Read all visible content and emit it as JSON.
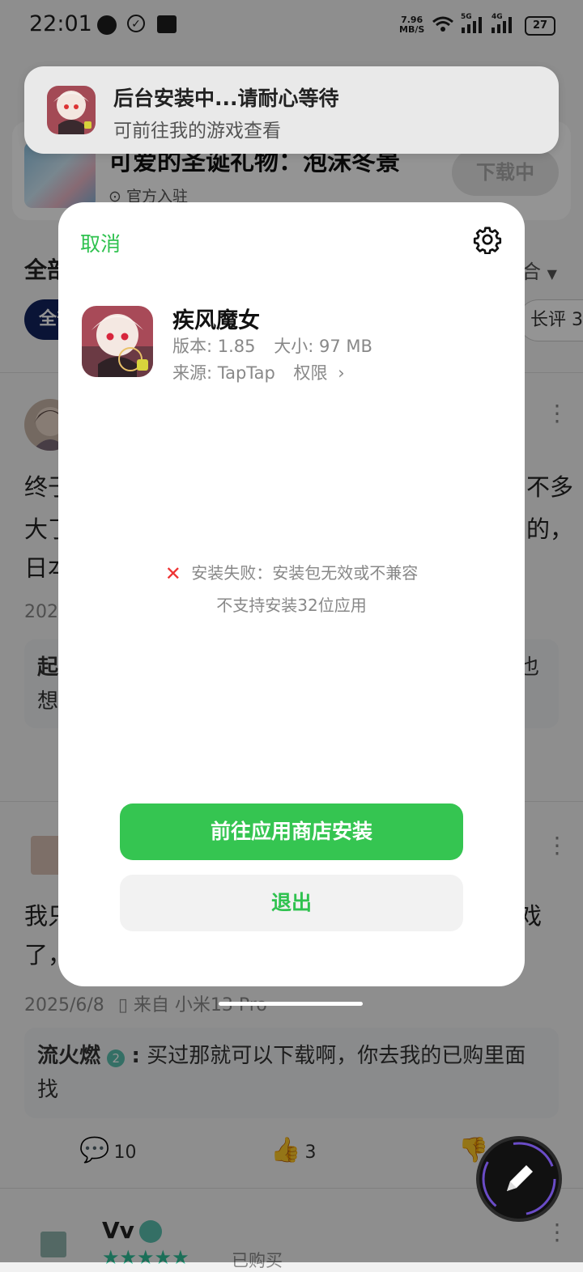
{
  "status_bar": {
    "time": "22:01",
    "net_speed_value": "7.96",
    "net_speed_unit": "MB/S",
    "signal_1": "5G",
    "signal_2": "4G",
    "battery": "27"
  },
  "toast": {
    "title": "后台安装中...请耐心等待",
    "subtitle": "可前往我的游戏查看"
  },
  "background": {
    "promo_title": "可爱的圣诞礼物：泡沫冬景",
    "promo_sub": "官方入驻",
    "download_button": "下载中",
    "filter_heading": "全部",
    "sort_label": "综合",
    "chip_all": "全部",
    "chip_long": "长评 3",
    "review1": {
      "line1": "终于",
      "line1_end": "不多",
      "line2": "大了",
      "line2_end": "的，",
      "line3": "日本",
      "date": "2025",
      "reply_line1_start": "起",
      "reply_line1_end": "也",
      "reply_line2": "想"
    },
    "review2": {
      "line1": "我只",
      "line1_end": "戏",
      "line2": "了，",
      "date": "2025/6/8",
      "device": "来自 小米13 Pro",
      "reply_user": "流火燃",
      "reply_text": "买过那就可以下载啊，你去我的已购里面找",
      "comments": "10",
      "likes": "3"
    },
    "review3": {
      "user": "Vv",
      "purchased": "已购买"
    }
  },
  "dialog": {
    "cancel": "取消",
    "app_name": "疾风魔女",
    "version_label": "版本: 1.85",
    "size_label": "大小: 97 MB",
    "source_label": "来源: TapTap",
    "permission_label": "权限",
    "error_line1": "安装失败：安装包无效或不兼容",
    "error_line2": "不支持安装32位应用",
    "primary_button": "前往应用商店安装",
    "secondary_button": "退出"
  },
  "colors": {
    "accent_green": "#35c551",
    "error_red": "#e33333",
    "chip_navy": "#12235e"
  }
}
